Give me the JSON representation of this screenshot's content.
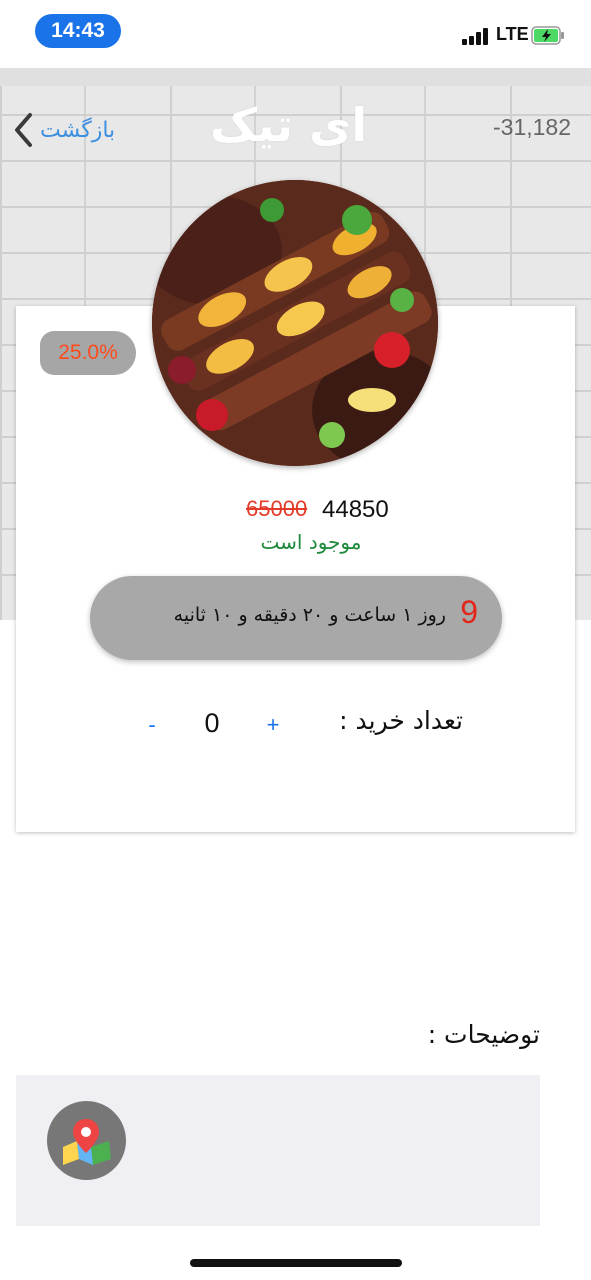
{
  "status_bar": {
    "time": "14:43",
    "network": "LTE",
    "signal_icon": "signal-bars-icon",
    "battery_icon": "battery-charging-icon"
  },
  "header": {
    "back_label": "بازگشت",
    "back_icon": "chevron-left-icon",
    "logo_text": "ای تیک",
    "counter": "-31,182"
  },
  "product": {
    "discount": "25.0%",
    "image_icon": "food-kebab-image",
    "old_price": "65000",
    "new_price": "44850",
    "stock_status": "موجود است"
  },
  "timer": {
    "days": "9",
    "text": "روز ۱ ساعت و ۲۰ دقیقه و ۱۰ ثانیه"
  },
  "quantity": {
    "label": "تعداد خرید :",
    "plus": "+",
    "value": "0",
    "minus": "-"
  },
  "description": {
    "label": "توضیحات :",
    "map_icon": "map-pin-icon"
  },
  "colors": {
    "accent": "#1a73e8",
    "price_strike": "#e33b2a",
    "stock": "#1e8a3c",
    "timer_days": "#e3261a",
    "discount": "#ff4a1a"
  }
}
